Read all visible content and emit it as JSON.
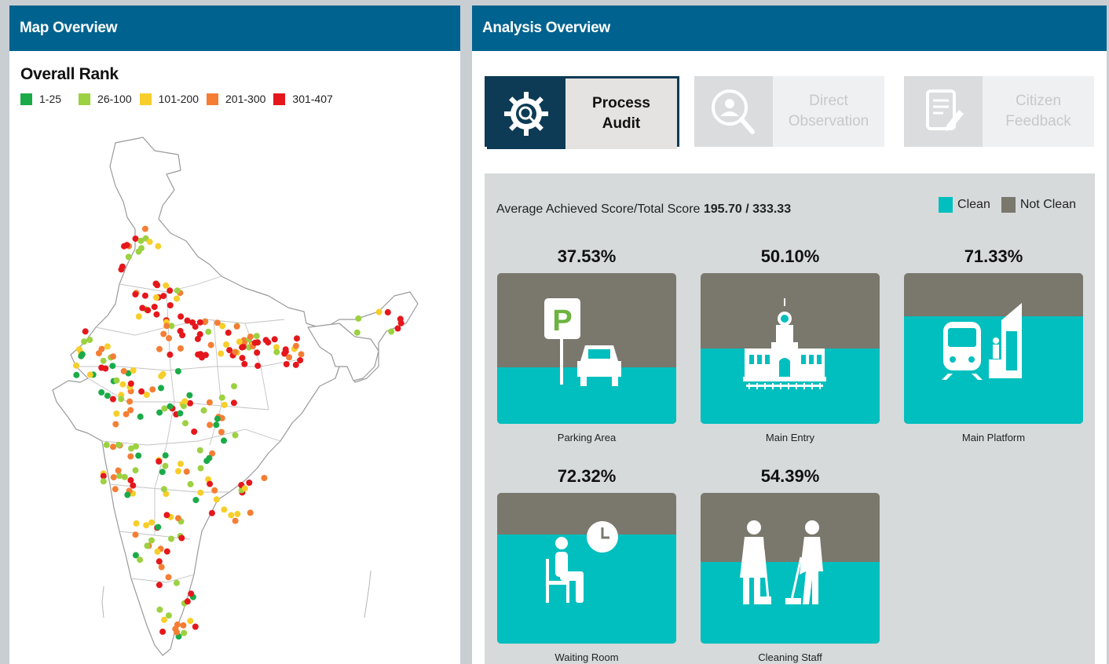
{
  "map": {
    "header": "Map Overview",
    "rank_title": "Overall Rank",
    "legend": [
      {
        "label": "1-25",
        "color": "#1aab48"
      },
      {
        "label": "26-100",
        "color": "#9cd141"
      },
      {
        "label": "101-200",
        "color": "#f7ce2a"
      },
      {
        "label": "201-300",
        "color": "#f57e34"
      },
      {
        "label": "301-407",
        "color": "#e5171c"
      }
    ]
  },
  "analysis": {
    "header": "Analysis Overview",
    "tabs": [
      {
        "label_line1": "Process",
        "label_line2": "Audit",
        "icon": "gear-search-icon",
        "active": true
      },
      {
        "label_line1": "Direct",
        "label_line2": "Observation",
        "icon": "magnifier-person-icon",
        "active": false
      },
      {
        "label_line1": "Citizen",
        "label_line2": "Feedback",
        "icon": "document-pen-icon",
        "active": false
      }
    ],
    "score_label": "Average Achieved Score/Total Score",
    "score_value": "195.70 / 333.33",
    "legend": [
      {
        "label": "Clean",
        "color": "#00bfbe"
      },
      {
        "label": "Not Clean",
        "color": "#7a776d"
      }
    ],
    "cards": [
      {
        "pct": "37.53%",
        "value": 37.53,
        "caption": "Parking Area",
        "icon": "parking-car-icon"
      },
      {
        "pct": "50.10%",
        "value": 50.1,
        "caption": "Main Entry",
        "icon": "station-building-icon"
      },
      {
        "pct": "71.33%",
        "value": 71.33,
        "caption": "Main Platform",
        "icon": "train-platform-icon"
      },
      {
        "pct": "72.32%",
        "value": 72.32,
        "caption": "Waiting Room",
        "icon": "seated-person-clock-icon"
      },
      {
        "pct": "54.39%",
        "value": 54.39,
        "caption": "Cleaning Staff",
        "icon": "cleaning-staff-icon"
      }
    ]
  }
}
